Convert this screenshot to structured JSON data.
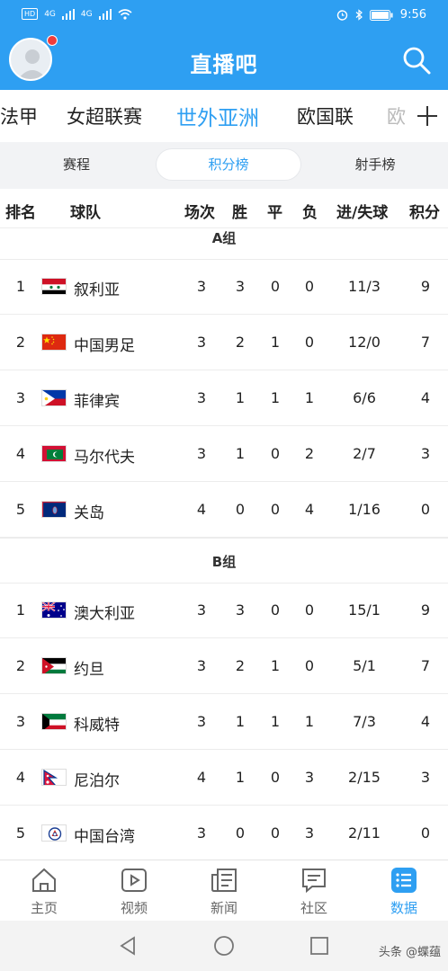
{
  "status_bar": {
    "time": "9:56",
    "hd_label": "HD",
    "network_1": "4G",
    "network_2": "4G"
  },
  "header": {
    "title": "直播吧"
  },
  "league_tabs": [
    {
      "label": "法甲"
    },
    {
      "label": "女超联赛"
    },
    {
      "label": "世外亚洲",
      "active": true
    },
    {
      "label": "欧国联"
    },
    {
      "label": "欧"
    }
  ],
  "segments": [
    {
      "label": "赛程"
    },
    {
      "label": "积分榜",
      "active": true
    },
    {
      "label": "射手榜"
    }
  ],
  "columns": [
    "排名",
    "球队",
    "场次",
    "胜",
    "平",
    "负",
    "进/失球",
    "积分"
  ],
  "groups": [
    {
      "name": "A组",
      "rows": [
        {
          "rank": "1",
          "team": "叙利亚",
          "flag": "syria",
          "played": "3",
          "won": "3",
          "drawn": "0",
          "lost": "0",
          "goals": "11/3",
          "points": "9"
        },
        {
          "rank": "2",
          "team": "中国男足",
          "flag": "china",
          "played": "3",
          "won": "2",
          "drawn": "1",
          "lost": "0",
          "goals": "12/0",
          "points": "7"
        },
        {
          "rank": "3",
          "team": "菲律宾",
          "flag": "philippines",
          "played": "3",
          "won": "1",
          "drawn": "1",
          "lost": "1",
          "goals": "6/6",
          "points": "4"
        },
        {
          "rank": "4",
          "team": "马尔代夫",
          "flag": "maldives",
          "played": "3",
          "won": "1",
          "drawn": "0",
          "lost": "2",
          "goals": "2/7",
          "points": "3"
        },
        {
          "rank": "5",
          "team": "关岛",
          "flag": "guam",
          "played": "4",
          "won": "0",
          "drawn": "0",
          "lost": "4",
          "goals": "1/16",
          "points": "0"
        }
      ]
    },
    {
      "name": "B组",
      "rows": [
        {
          "rank": "1",
          "team": "澳大利亚",
          "flag": "australia",
          "played": "3",
          "won": "3",
          "drawn": "0",
          "lost": "0",
          "goals": "15/1",
          "points": "9"
        },
        {
          "rank": "2",
          "team": "约旦",
          "flag": "jordan",
          "played": "3",
          "won": "2",
          "drawn": "1",
          "lost": "0",
          "goals": "5/1",
          "points": "7"
        },
        {
          "rank": "3",
          "team": "科威特",
          "flag": "kuwait",
          "played": "3",
          "won": "1",
          "drawn": "1",
          "lost": "1",
          "goals": "7/3",
          "points": "4"
        },
        {
          "rank": "4",
          "team": "尼泊尔",
          "flag": "nepal",
          "played": "4",
          "won": "1",
          "drawn": "0",
          "lost": "3",
          "goals": "2/15",
          "points": "3"
        },
        {
          "rank": "5",
          "team": "中国台湾",
          "flag": "chinese-taipei",
          "played": "3",
          "won": "0",
          "drawn": "0",
          "lost": "3",
          "goals": "2/11",
          "points": "0"
        }
      ]
    }
  ],
  "bottom_nav": [
    {
      "label": "主页",
      "icon": "home-icon"
    },
    {
      "label": "视频",
      "icon": "video-icon"
    },
    {
      "label": "新闻",
      "icon": "news-icon"
    },
    {
      "label": "社区",
      "icon": "community-icon"
    },
    {
      "label": "数据",
      "icon": "data-icon",
      "active": true
    }
  ],
  "watermark": "头条 @蝶蕴",
  "colors": {
    "brand": "#2e9ff2",
    "badge": "#f03c3c"
  }
}
